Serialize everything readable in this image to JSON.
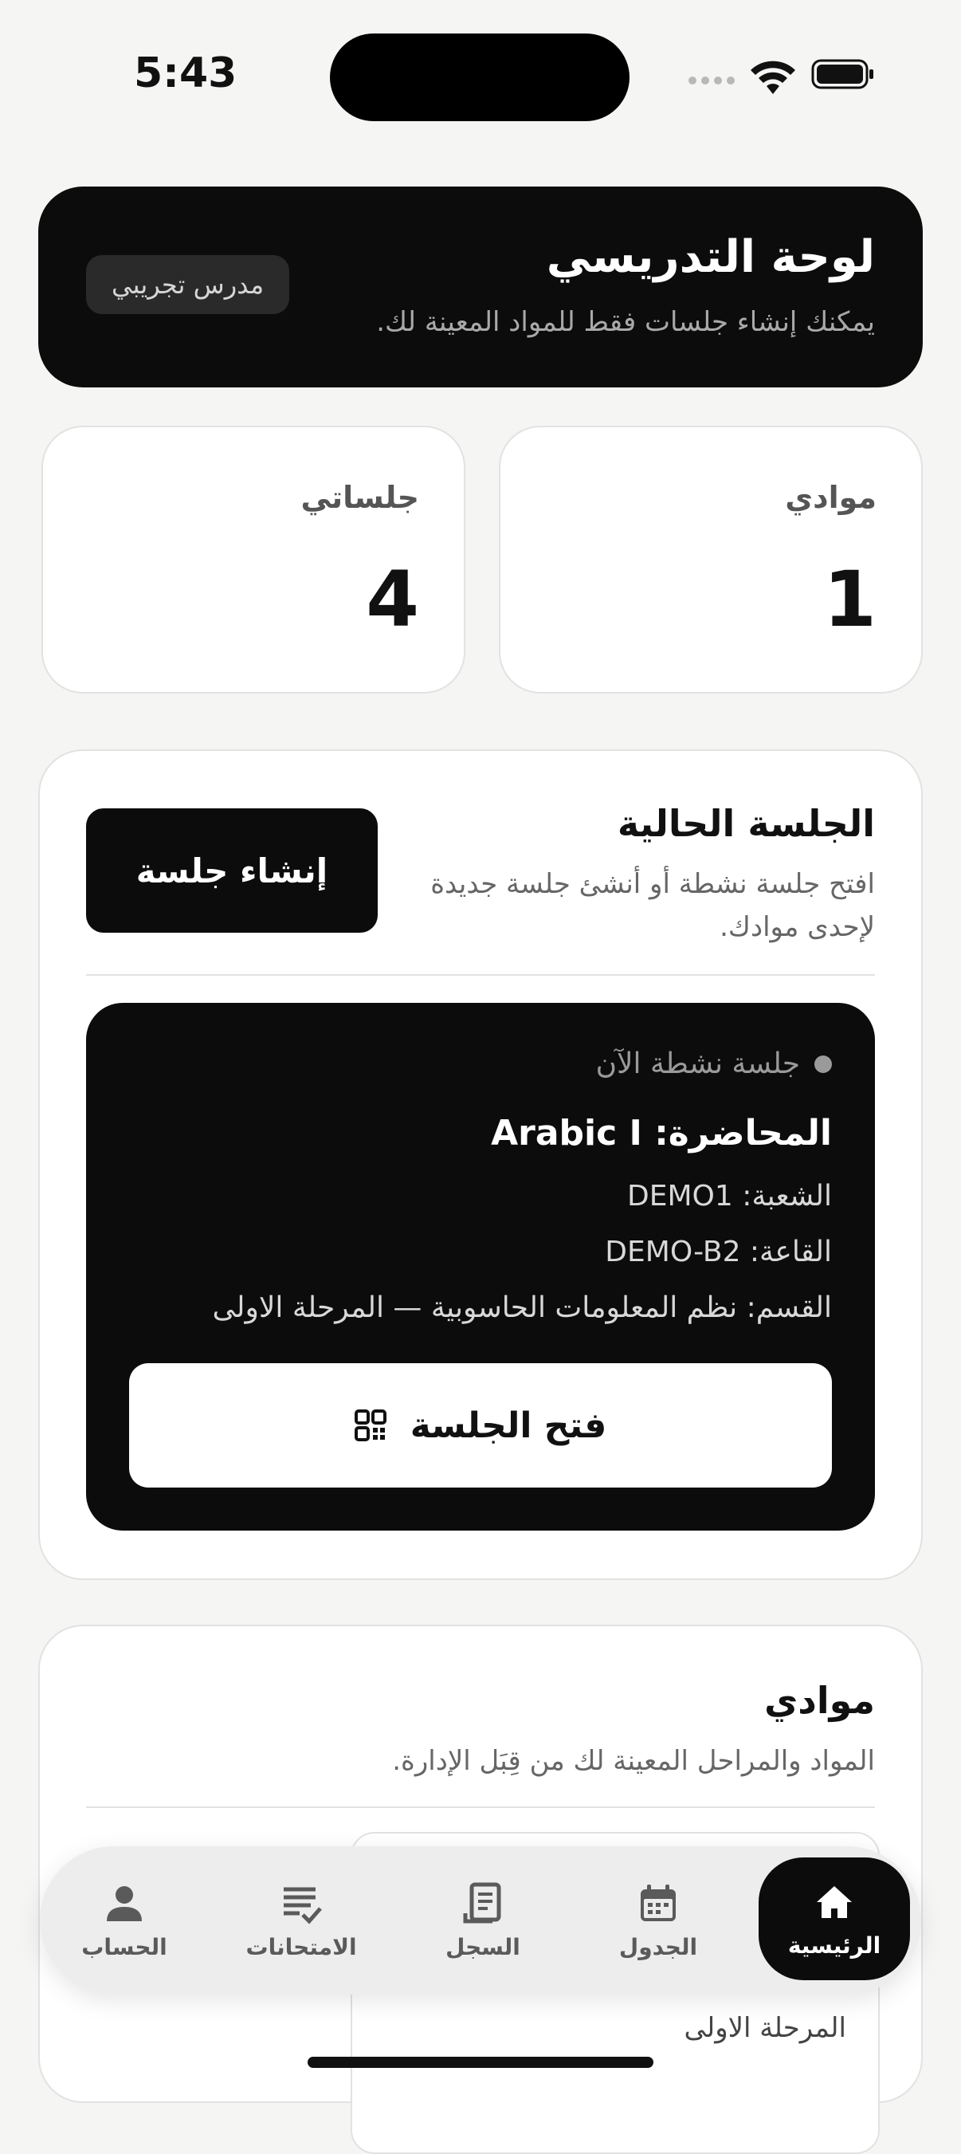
{
  "status_bar": {
    "time": "5:43"
  },
  "header": {
    "title": "لوحة التدريسي",
    "subtitle": "يمكنك إنشاء جلسات فقط للمواد المعينة لك.",
    "badge": "مدرس تجريبي"
  },
  "stats": [
    {
      "label": "موادي",
      "value": "1"
    },
    {
      "label": "جلساتي",
      "value": "4"
    }
  ],
  "current_session": {
    "title": "الجلسة الحالية",
    "subtitle_line1": "افتح جلسة نشطة أو أنشئ جلسة جديدة",
    "subtitle_line2": "لإحدى موادك.",
    "create_button": "إنشاء جلسة",
    "card": {
      "status": "جلسة نشطة الآن",
      "course": "المحاضرة: Arabic I",
      "section": "الشعبة: DEMO1",
      "room": "القاعة: DEMO-B2",
      "department": "القسم: نظم المعلومات الحاسوبية — المرحلة الاولى",
      "open_button": "فتح الجلسة"
    }
  },
  "subjects": {
    "title": "موادي",
    "subtitle": "المواد والمراحل المعينة لك من قِبَل الإدارة.",
    "peek_text": "المرحلة الاولى"
  },
  "tabbar": {
    "items": [
      {
        "label": "الرئيسية",
        "icon": "home-icon",
        "active": true
      },
      {
        "label": "الجدول",
        "icon": "calendar-icon",
        "active": false
      },
      {
        "label": "السجل",
        "icon": "receipt-icon",
        "active": false
      },
      {
        "label": "الامتحانات",
        "icon": "checklist-icon",
        "active": false
      },
      {
        "label": "الحساب",
        "icon": "person-icon",
        "active": false
      }
    ]
  }
}
